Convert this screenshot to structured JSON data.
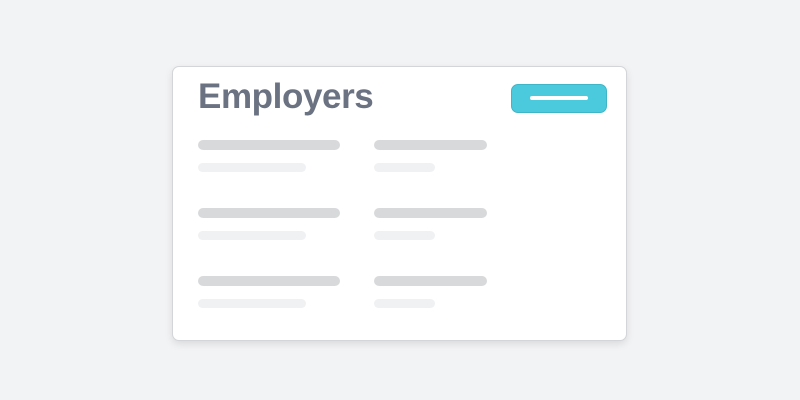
{
  "card": {
    "title": "Employers",
    "accent_color": "#4ccadd",
    "rows": [
      {
        "id": 1,
        "state": "loading"
      },
      {
        "id": 2,
        "state": "loading"
      },
      {
        "id": 3,
        "state": "loading"
      }
    ]
  }
}
